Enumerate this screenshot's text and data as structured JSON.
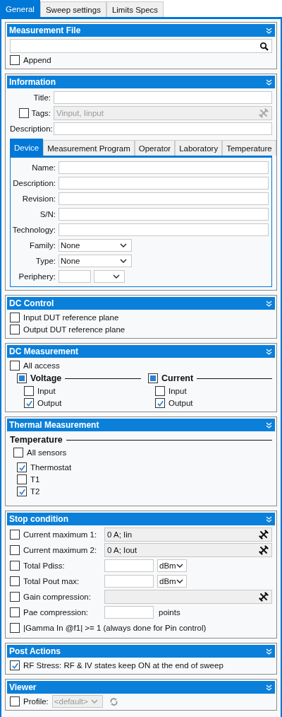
{
  "tabs": [
    {
      "label": "General",
      "selected": true
    },
    {
      "label": "Sweep settings",
      "selected": false
    },
    {
      "label": "Limits Specs",
      "selected": false
    }
  ],
  "measurement_file": {
    "title": "Measurement File",
    "append": {
      "label": "Append",
      "checked": false
    }
  },
  "information": {
    "title": "Information",
    "title_field": {
      "label": "Title:"
    },
    "tags": {
      "label": "Tags:",
      "checked": false,
      "placeholder": "Vinput, Iinput",
      "disabled": true
    },
    "description": {
      "label": "Description:"
    },
    "subtabs": [
      {
        "label": "Device",
        "selected": true
      },
      {
        "label": "Measurement Program",
        "selected": false
      },
      {
        "label": "Operator",
        "selected": false
      },
      {
        "label": "Laboratory",
        "selected": false
      },
      {
        "label": "Temperature",
        "selected": false
      }
    ],
    "device_fields": [
      {
        "label": "Name:",
        "kind": "text"
      },
      {
        "label": "Description:",
        "kind": "text"
      },
      {
        "label": "Revision:",
        "kind": "text"
      },
      {
        "label": "S/N:",
        "kind": "text"
      },
      {
        "label": "Technology:",
        "kind": "text"
      },
      {
        "label": "Family:",
        "kind": "select",
        "value": "None"
      },
      {
        "label": "Type:",
        "kind": "select",
        "value": "None"
      },
      {
        "label": "Periphery:",
        "kind": "periphery"
      }
    ]
  },
  "dc_control": {
    "title": "DC Control",
    "options": [
      {
        "label": "Input DUT reference plane",
        "checked": false
      },
      {
        "label": "Output DUT reference plane",
        "checked": false
      }
    ]
  },
  "dc_measurement": {
    "title": "DC Measurement",
    "all_access": {
      "label": "All access",
      "checked": false
    },
    "groups": [
      {
        "label": "Voltage",
        "indeterminate": true,
        "items": [
          {
            "label": "Input",
            "checked": false
          },
          {
            "label": "Output",
            "checked": true
          }
        ]
      },
      {
        "label": "Current",
        "indeterminate": true,
        "items": [
          {
            "label": "Input",
            "checked": false
          },
          {
            "label": "Output",
            "checked": true
          }
        ]
      }
    ]
  },
  "thermal_measurement": {
    "title": "Thermal Measurement",
    "group": "Temperature",
    "all_sensors": {
      "label": "All sensors",
      "checked": false
    },
    "sensors": [
      {
        "label": "Thermostat",
        "checked": true
      },
      {
        "label": "T1",
        "checked": false
      },
      {
        "label": "T2",
        "checked": true
      }
    ]
  },
  "stop_condition": {
    "title": "Stop condition",
    "rows": [
      {
        "kind": "tool",
        "label": "Current maximum 1:",
        "checked": false,
        "value": "0 A; Iin"
      },
      {
        "kind": "tool",
        "label": "Current maximum 2:",
        "checked": false,
        "value": "0 A; Iout"
      },
      {
        "kind": "unit",
        "label": "Total Pdiss:",
        "checked": false,
        "unit": "dBm"
      },
      {
        "kind": "unit",
        "label": "Total Pout max:",
        "checked": false,
        "unit": "dBm"
      },
      {
        "kind": "tool",
        "label": "Gain compression:",
        "checked": false
      },
      {
        "kind": "points",
        "label": "Pae compression:",
        "checked": false,
        "suffix": "points"
      },
      {
        "kind": "plain",
        "label": "|Gamma In @f1| >= 1 (always done for Pin control)",
        "checked": false
      }
    ]
  },
  "post_actions": {
    "title": "Post Actions",
    "options": [
      {
        "label": "RF Stress: RF & IV states keep ON at the end of sweep",
        "checked": true
      }
    ]
  },
  "viewer": {
    "title": "Viewer",
    "profile": {
      "label": "Profile:",
      "checked": false,
      "value": "<default>",
      "disabled": true
    }
  }
}
